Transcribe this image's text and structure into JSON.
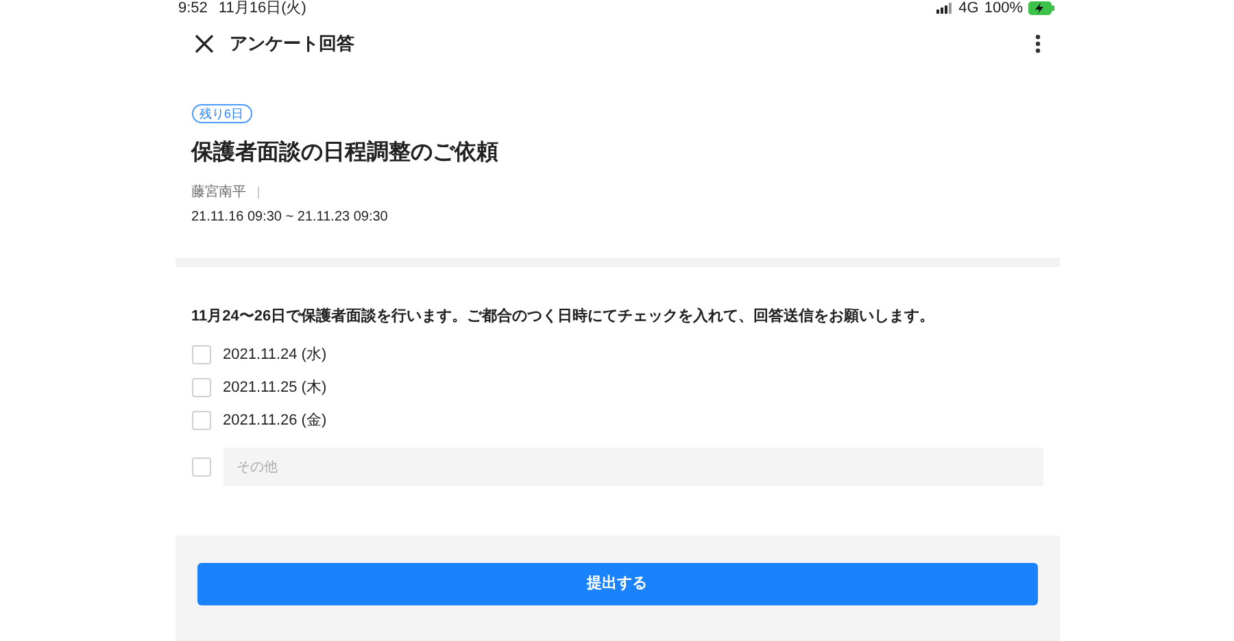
{
  "status_bar": {
    "time": "9:52",
    "date": "11月16日(火)",
    "network": "4G",
    "battery": "100%"
  },
  "header": {
    "title": "アンケート回答"
  },
  "survey": {
    "badge": "残り6日",
    "title": "保護者面談の日程調整のご依頼",
    "author": "藤宮南平",
    "period": "21.11.16 09:30 ~ 21.11.23 09:30"
  },
  "question": {
    "text": "11月24〜26日で保護者面談を行います。ご都合のつく日時にてチェックを入れて、回答送信をお願いします。",
    "options": [
      {
        "kind": "choice",
        "label": "2021.11.24 (水)",
        "checked": false
      },
      {
        "kind": "choice",
        "label": "2021.11.25 (木)",
        "checked": false
      },
      {
        "kind": "choice",
        "label": "2021.11.26 (金)",
        "checked": false
      },
      {
        "kind": "other",
        "placeholder": "その他",
        "checked": false
      }
    ]
  },
  "submit_button": "提出する"
}
